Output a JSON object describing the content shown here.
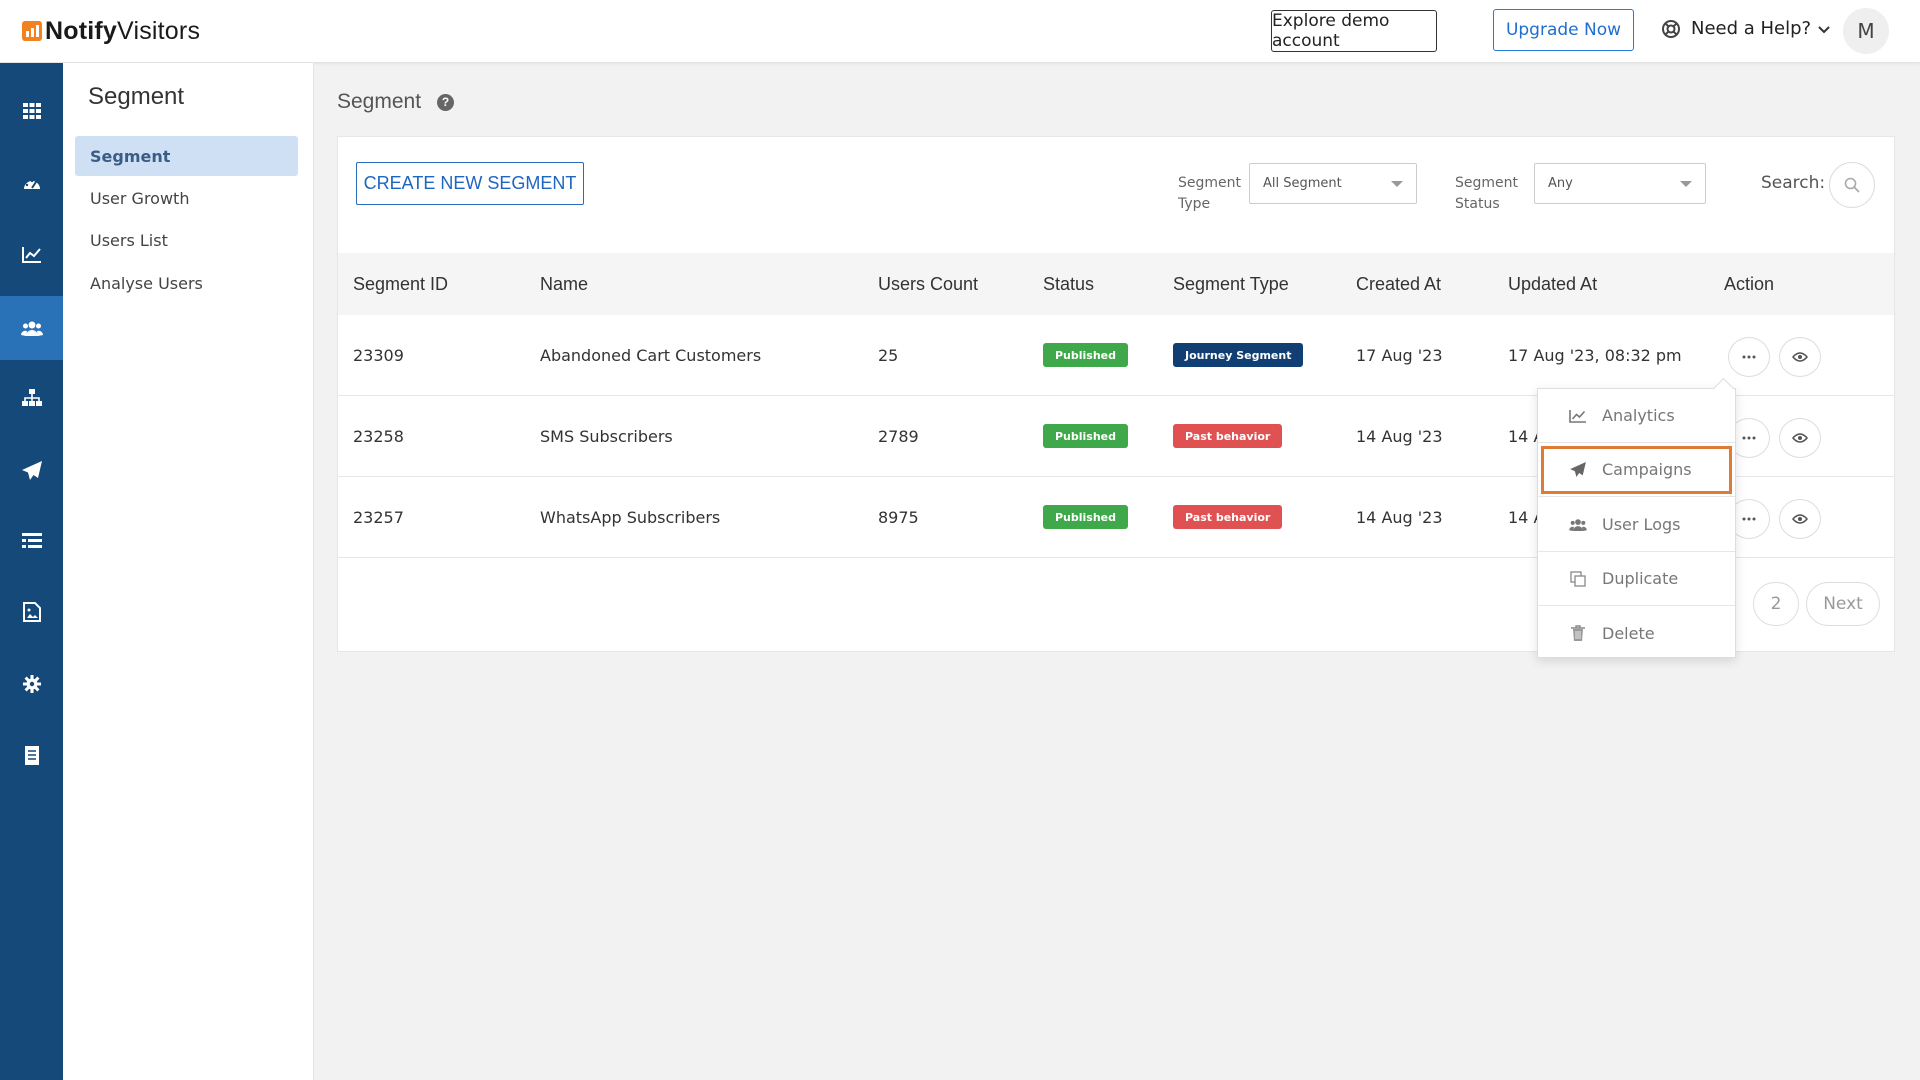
{
  "header": {
    "logo_bold": "Notify",
    "logo_rest": "Visitors",
    "explore_demo": "Explore demo account",
    "upgrade": "Upgrade Now",
    "help": "Need a Help?",
    "avatar_initial": "M"
  },
  "rail": {
    "icons": [
      "grid-icon",
      "dashboard-icon",
      "chart-icon",
      "users-icon",
      "hierarchy-icon",
      "send-icon",
      "list-icon",
      "image-doc-icon",
      "settings-icon",
      "document-icon"
    ],
    "active_index": 3
  },
  "subnav": {
    "title": "Segment",
    "items": [
      "Segment",
      "User Growth",
      "Users List",
      "Analyse Users"
    ]
  },
  "page": {
    "title": "Segment",
    "create_button": "CREATE NEW SEGMENT",
    "segment_type_label_1": "Segment",
    "segment_type_label_2": "Type",
    "segment_type_value": "All Segment",
    "segment_status_label_1": "Segment",
    "segment_status_label_2": "Status",
    "segment_status_value": "Any",
    "search_label": "Search:"
  },
  "table": {
    "headers": [
      "Segment ID",
      "Name",
      "Users Count",
      "Status",
      "Segment Type",
      "Created At",
      "Updated At",
      "Action"
    ],
    "rows": [
      {
        "id": "23309",
        "name": "Abandoned Cart Customers",
        "count": "25",
        "status": "Published",
        "type": "Journey Segment",
        "type_color": "#123f73",
        "created": "17 Aug '23",
        "updated": "17 Aug '23, 08:32 pm"
      },
      {
        "id": "23258",
        "name": "SMS Subscribers",
        "count": "2789",
        "status": "Published",
        "type": "Past behavior",
        "type_color": "#e05252",
        "created": "14 Aug '23",
        "updated": "14 A"
      },
      {
        "id": "23257",
        "name": "WhatsApp Subscribers",
        "count": "8975",
        "status": "Published",
        "type": "Past behavior",
        "type_color": "#e05252",
        "created": "14 Aug '23",
        "updated": "14 A"
      }
    ],
    "status_color": "#3fa84a"
  },
  "pagination": {
    "page2": "2",
    "next": "Next"
  },
  "action_menu": {
    "items": [
      "Analytics",
      "Campaigns",
      "User Logs",
      "Duplicate",
      "Delete"
    ],
    "highlighted_index": 1
  },
  "colors": {
    "rail_bg": "#14497a",
    "rail_active": "#2a72b8",
    "accent_blue": "#1f66c1",
    "highlight_border": "#e07b35"
  }
}
